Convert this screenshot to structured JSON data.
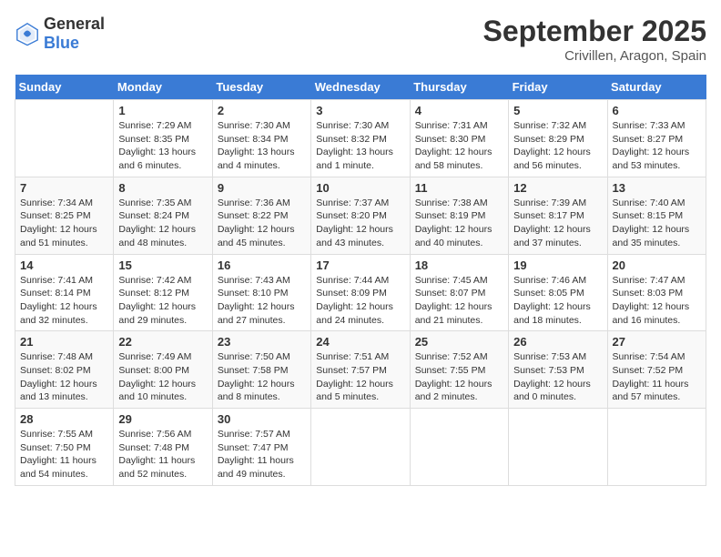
{
  "logo": {
    "text_general": "General",
    "text_blue": "Blue"
  },
  "header": {
    "month": "September 2025",
    "location": "Crivillen, Aragon, Spain"
  },
  "weekdays": [
    "Sunday",
    "Monday",
    "Tuesday",
    "Wednesday",
    "Thursday",
    "Friday",
    "Saturday"
  ],
  "weeks": [
    [
      {
        "day": "",
        "sunrise": "",
        "sunset": "",
        "daylight": ""
      },
      {
        "day": "1",
        "sunrise": "Sunrise: 7:29 AM",
        "sunset": "Sunset: 8:35 PM",
        "daylight": "Daylight: 13 hours and 6 minutes."
      },
      {
        "day": "2",
        "sunrise": "Sunrise: 7:30 AM",
        "sunset": "Sunset: 8:34 PM",
        "daylight": "Daylight: 13 hours and 4 minutes."
      },
      {
        "day": "3",
        "sunrise": "Sunrise: 7:30 AM",
        "sunset": "Sunset: 8:32 PM",
        "daylight": "Daylight: 13 hours and 1 minute."
      },
      {
        "day": "4",
        "sunrise": "Sunrise: 7:31 AM",
        "sunset": "Sunset: 8:30 PM",
        "daylight": "Daylight: 12 hours and 58 minutes."
      },
      {
        "day": "5",
        "sunrise": "Sunrise: 7:32 AM",
        "sunset": "Sunset: 8:29 PM",
        "daylight": "Daylight: 12 hours and 56 minutes."
      },
      {
        "day": "6",
        "sunrise": "Sunrise: 7:33 AM",
        "sunset": "Sunset: 8:27 PM",
        "daylight": "Daylight: 12 hours and 53 minutes."
      }
    ],
    [
      {
        "day": "7",
        "sunrise": "Sunrise: 7:34 AM",
        "sunset": "Sunset: 8:25 PM",
        "daylight": "Daylight: 12 hours and 51 minutes."
      },
      {
        "day": "8",
        "sunrise": "Sunrise: 7:35 AM",
        "sunset": "Sunset: 8:24 PM",
        "daylight": "Daylight: 12 hours and 48 minutes."
      },
      {
        "day": "9",
        "sunrise": "Sunrise: 7:36 AM",
        "sunset": "Sunset: 8:22 PM",
        "daylight": "Daylight: 12 hours and 45 minutes."
      },
      {
        "day": "10",
        "sunrise": "Sunrise: 7:37 AM",
        "sunset": "Sunset: 8:20 PM",
        "daylight": "Daylight: 12 hours and 43 minutes."
      },
      {
        "day": "11",
        "sunrise": "Sunrise: 7:38 AM",
        "sunset": "Sunset: 8:19 PM",
        "daylight": "Daylight: 12 hours and 40 minutes."
      },
      {
        "day": "12",
        "sunrise": "Sunrise: 7:39 AM",
        "sunset": "Sunset: 8:17 PM",
        "daylight": "Daylight: 12 hours and 37 minutes."
      },
      {
        "day": "13",
        "sunrise": "Sunrise: 7:40 AM",
        "sunset": "Sunset: 8:15 PM",
        "daylight": "Daylight: 12 hours and 35 minutes."
      }
    ],
    [
      {
        "day": "14",
        "sunrise": "Sunrise: 7:41 AM",
        "sunset": "Sunset: 8:14 PM",
        "daylight": "Daylight: 12 hours and 32 minutes."
      },
      {
        "day": "15",
        "sunrise": "Sunrise: 7:42 AM",
        "sunset": "Sunset: 8:12 PM",
        "daylight": "Daylight: 12 hours and 29 minutes."
      },
      {
        "day": "16",
        "sunrise": "Sunrise: 7:43 AM",
        "sunset": "Sunset: 8:10 PM",
        "daylight": "Daylight: 12 hours and 27 minutes."
      },
      {
        "day": "17",
        "sunrise": "Sunrise: 7:44 AM",
        "sunset": "Sunset: 8:09 PM",
        "daylight": "Daylight: 12 hours and 24 minutes."
      },
      {
        "day": "18",
        "sunrise": "Sunrise: 7:45 AM",
        "sunset": "Sunset: 8:07 PM",
        "daylight": "Daylight: 12 hours and 21 minutes."
      },
      {
        "day": "19",
        "sunrise": "Sunrise: 7:46 AM",
        "sunset": "Sunset: 8:05 PM",
        "daylight": "Daylight: 12 hours and 18 minutes."
      },
      {
        "day": "20",
        "sunrise": "Sunrise: 7:47 AM",
        "sunset": "Sunset: 8:03 PM",
        "daylight": "Daylight: 12 hours and 16 minutes."
      }
    ],
    [
      {
        "day": "21",
        "sunrise": "Sunrise: 7:48 AM",
        "sunset": "Sunset: 8:02 PM",
        "daylight": "Daylight: 12 hours and 13 minutes."
      },
      {
        "day": "22",
        "sunrise": "Sunrise: 7:49 AM",
        "sunset": "Sunset: 8:00 PM",
        "daylight": "Daylight: 12 hours and 10 minutes."
      },
      {
        "day": "23",
        "sunrise": "Sunrise: 7:50 AM",
        "sunset": "Sunset: 7:58 PM",
        "daylight": "Daylight: 12 hours and 8 minutes."
      },
      {
        "day": "24",
        "sunrise": "Sunrise: 7:51 AM",
        "sunset": "Sunset: 7:57 PM",
        "daylight": "Daylight: 12 hours and 5 minutes."
      },
      {
        "day": "25",
        "sunrise": "Sunrise: 7:52 AM",
        "sunset": "Sunset: 7:55 PM",
        "daylight": "Daylight: 12 hours and 2 minutes."
      },
      {
        "day": "26",
        "sunrise": "Sunrise: 7:53 AM",
        "sunset": "Sunset: 7:53 PM",
        "daylight": "Daylight: 12 hours and 0 minutes."
      },
      {
        "day": "27",
        "sunrise": "Sunrise: 7:54 AM",
        "sunset": "Sunset: 7:52 PM",
        "daylight": "Daylight: 11 hours and 57 minutes."
      }
    ],
    [
      {
        "day": "28",
        "sunrise": "Sunrise: 7:55 AM",
        "sunset": "Sunset: 7:50 PM",
        "daylight": "Daylight: 11 hours and 54 minutes."
      },
      {
        "day": "29",
        "sunrise": "Sunrise: 7:56 AM",
        "sunset": "Sunset: 7:48 PM",
        "daylight": "Daylight: 11 hours and 52 minutes."
      },
      {
        "day": "30",
        "sunrise": "Sunrise: 7:57 AM",
        "sunset": "Sunset: 7:47 PM",
        "daylight": "Daylight: 11 hours and 49 minutes."
      },
      {
        "day": "",
        "sunrise": "",
        "sunset": "",
        "daylight": ""
      },
      {
        "day": "",
        "sunrise": "",
        "sunset": "",
        "daylight": ""
      },
      {
        "day": "",
        "sunrise": "",
        "sunset": "",
        "daylight": ""
      },
      {
        "day": "",
        "sunrise": "",
        "sunset": "",
        "daylight": ""
      }
    ]
  ]
}
